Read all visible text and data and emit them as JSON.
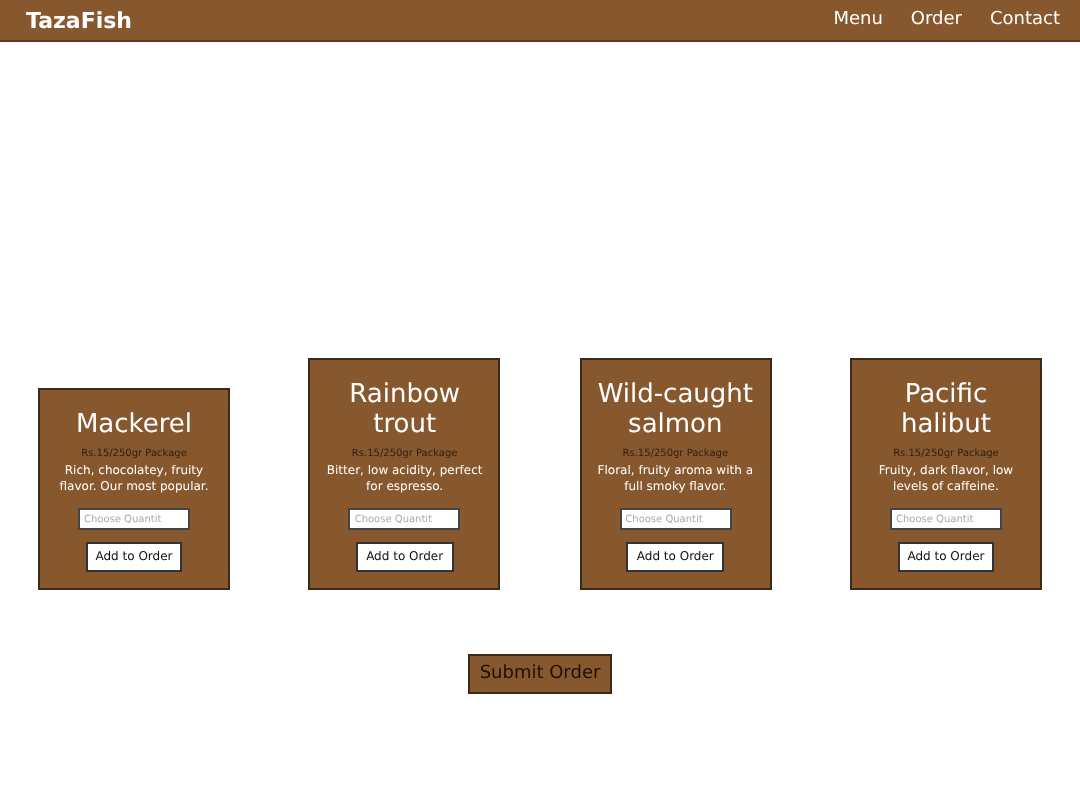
{
  "header": {
    "brand": "TazaFish",
    "nav": [
      "Menu",
      "Order",
      "Contact"
    ]
  },
  "products": [
    {
      "name": "Mackerel",
      "price": "Rs.15/250gr Package",
      "description": "Rich, chocolatey, fruity flavor. Our most popular.",
      "quantity_placeholder": "Choose Quantit",
      "button": "Add to Order"
    },
    {
      "name": "Rainbow trout",
      "price": "Rs.15/250gr Package",
      "description": "Bitter, low acidity, perfect for espresso.",
      "quantity_placeholder": "Choose Quantit",
      "button": "Add to Order"
    },
    {
      "name": "Wild-caught salmon",
      "price": "Rs.15/250gr Package",
      "description": "Floral, fruity aroma with a full smoky flavor.",
      "quantity_placeholder": "Choose Quantit",
      "button": "Add to Order"
    },
    {
      "name": "Pacific halibut",
      "price": "Rs.15/250gr Package",
      "description": "Fruity, dark flavor, low levels of caffeine.",
      "quantity_placeholder": "Choose Quantit",
      "button": "Add to Order"
    }
  ],
  "submit": "Submit Order"
}
